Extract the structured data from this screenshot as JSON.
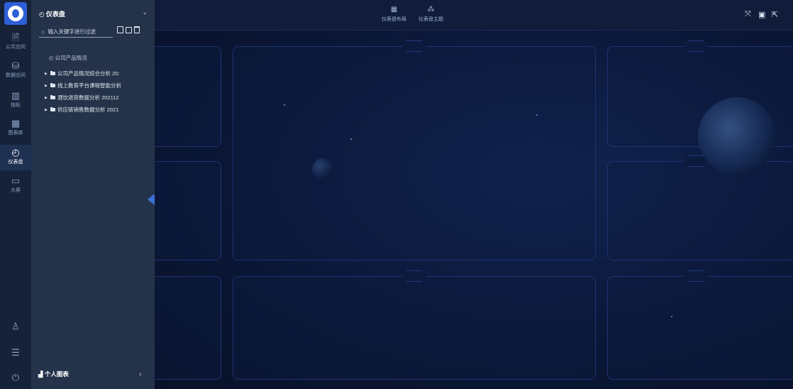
{
  "rail": {
    "items": [
      {
        "label": "公共空间",
        "icon": "document-icon",
        "glyph": "🗎"
      },
      {
        "label": "数据空间",
        "icon": "database-icon",
        "glyph": "⛁"
      },
      {
        "label": "指标",
        "icon": "bar-chart-icon",
        "glyph": "▥"
      },
      {
        "label": "图表库",
        "icon": "chart-library-icon",
        "glyph": "▦"
      },
      {
        "label": "仪表盘",
        "icon": "gauge-icon",
        "glyph": "◴"
      },
      {
        "label": "大屏",
        "icon": "monitor-icon",
        "glyph": "▭"
      }
    ],
    "bottom": [
      {
        "icon": "user-icon",
        "glyph": "♙"
      },
      {
        "icon": "settings-sliders-icon",
        "glyph": "☰"
      },
      {
        "icon": "power-icon",
        "glyph": "⏻"
      }
    ],
    "active_index": 4
  },
  "panel": {
    "title_icon": "◴",
    "title": "仪表盘",
    "chevron": "⌄",
    "search": {
      "placeholder": "输入关键字进行过滤",
      "value": "",
      "icon": "○"
    },
    "tree_root": "◴ 公司产品情况",
    "items": [
      "公司产品情况综合分析 20:",
      "线上教育平台课程智能分析",
      "酒饮退货数据分析 202112",
      "供应链销售数据分析 2021"
    ],
    "footer_icon": "▟",
    "footer": "个人图表",
    "footer_chevron": "›"
  },
  "topbar": {
    "layout": {
      "label": "仪表盘布局",
      "glyph": "▦"
    },
    "theme": {
      "label": "仪表盘主题",
      "glyph": "⁂"
    },
    "right": [
      {
        "icon": "fullscreen-icon",
        "glyph": "⤧"
      },
      {
        "icon": "save-icon",
        "glyph": "▣"
      },
      {
        "icon": "share-icon",
        "glyph": "⇱"
      }
    ]
  },
  "colors": {
    "accent": "#3d6fd9",
    "rail_bg": "#152238",
    "panel_bg": "#243349",
    "canvas_bg": "#0b1738"
  }
}
